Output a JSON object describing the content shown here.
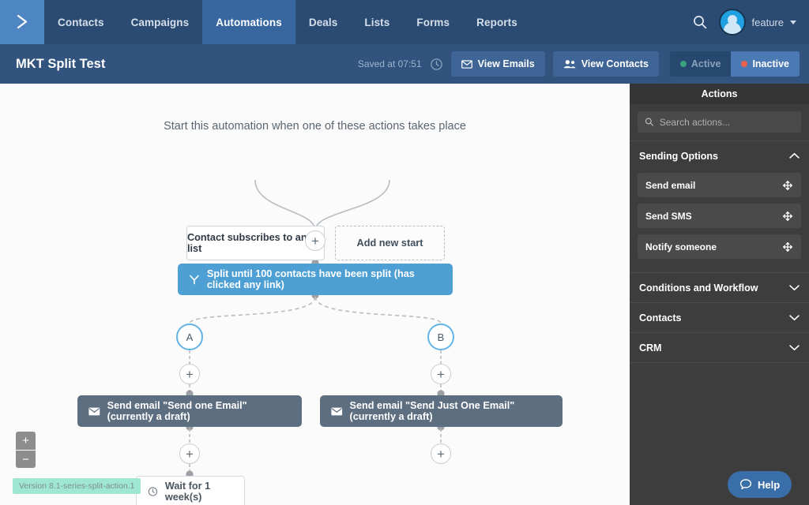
{
  "nav": {
    "logo_icon": "chevron-right-logo",
    "items": [
      {
        "label": "Contacts",
        "active": false
      },
      {
        "label": "Campaigns",
        "active": false
      },
      {
        "label": "Automations",
        "active": true
      },
      {
        "label": "Deals",
        "active": false
      },
      {
        "label": "Lists",
        "active": false
      },
      {
        "label": "Forms",
        "active": false
      },
      {
        "label": "Reports",
        "active": false
      }
    ],
    "search_icon": "search-icon",
    "user_name": "feature",
    "avatar_icon": "user-avatar-icon",
    "caret_icon": "chevron-down-icon"
  },
  "subheader": {
    "title": "MKT Split Test",
    "saved_text": "Saved at 07:51",
    "history_icon": "clock-history-icon",
    "view_emails_label": "View Emails",
    "view_emails_icon": "envelope-icon",
    "view_contacts_label": "View Contacts",
    "view_contacts_icon": "people-icon",
    "status_active_label": "Active",
    "status_inactive_label": "Inactive",
    "status_selected": "Inactive",
    "active_dot_color": "#3aa17e",
    "inactive_dot_color": "#e8604c"
  },
  "canvas": {
    "hint": "Start this automation when one of these actions takes place",
    "triggers": [
      {
        "label": "Contact subscribes to any list",
        "style": "solid"
      },
      {
        "label": "Add new start",
        "style": "dashed"
      }
    ],
    "add_step_label": "+",
    "split_node": {
      "label": "Split until 100 contacts have been split (has clicked any link)",
      "icon": "split-fork-icon",
      "color": "#4d9fd4"
    },
    "branch_a": "A",
    "branch_b": "B",
    "email_a": {
      "label": "Send email \"Send one Email\" (currently a draft)",
      "icon": "envelope-icon"
    },
    "email_b": {
      "label": "Send email \"Send Just One Email\" (currently a draft)",
      "icon": "envelope-icon"
    },
    "wait_node": {
      "label": "Wait for 1 week(s)",
      "icon": "clock-icon"
    },
    "zoom_in_label": "+",
    "zoom_out_label": "−",
    "version_badge": "Version 8.1-series-split-action.1"
  },
  "sidebar": {
    "title": "Actions",
    "search_placeholder": "Search actions...",
    "search_value": "",
    "search_icon": "search-icon",
    "sections": [
      {
        "label": "Sending Options",
        "expanded": true,
        "chevron": "chevron-up-icon",
        "items": [
          {
            "label": "Send email",
            "handle": "drag-move-icon"
          },
          {
            "label": "Send SMS",
            "handle": "drag-move-icon"
          },
          {
            "label": "Notify someone",
            "handle": "drag-move-icon"
          }
        ]
      },
      {
        "label": "Conditions and Workflow",
        "expanded": false,
        "chevron": "chevron-down-icon",
        "items": []
      },
      {
        "label": "Contacts",
        "expanded": false,
        "chevron": "chevron-down-icon",
        "items": []
      },
      {
        "label": "CRM",
        "expanded": false,
        "chevron": "chevron-down-icon",
        "items": []
      }
    ]
  },
  "help": {
    "label": "Help",
    "icon": "chat-bubble-icon"
  }
}
